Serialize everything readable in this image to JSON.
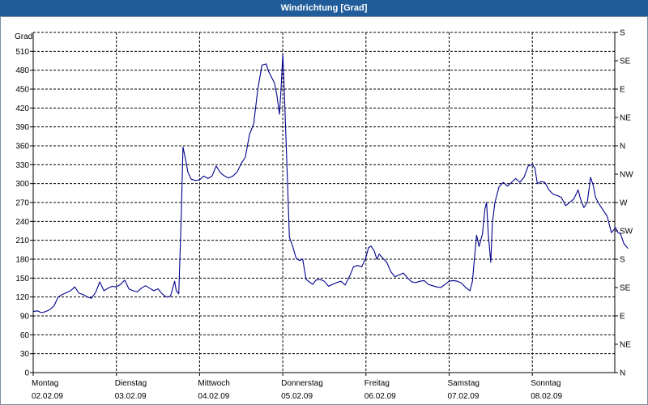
{
  "window": {
    "title": "Windrichtung [Grad]"
  },
  "chart_data": {
    "type": "line",
    "title": "Windrichtung [Grad]",
    "ylabel": "Grad",
    "ylim": [
      0,
      540
    ],
    "y_ticks": [
      0,
      30,
      60,
      90,
      120,
      150,
      180,
      210,
      240,
      270,
      300,
      330,
      360,
      390,
      420,
      450,
      480,
      510
    ],
    "right_axis_ticks": [
      {
        "value": 0,
        "label": "N"
      },
      {
        "value": 45,
        "label": "NE"
      },
      {
        "value": 90,
        "label": "E"
      },
      {
        "value": 135,
        "label": "SE"
      },
      {
        "value": 180,
        "label": "S"
      },
      {
        "value": 225,
        "label": "SW"
      },
      {
        "value": 270,
        "label": "W"
      },
      {
        "value": 315,
        "label": "NW"
      },
      {
        "value": 360,
        "label": "N"
      },
      {
        "value": 405,
        "label": "NE"
      },
      {
        "value": 450,
        "label": "E"
      },
      {
        "value": 495,
        "label": "SE"
      },
      {
        "value": 540,
        "label": "S"
      }
    ],
    "x_range_days": [
      0,
      7
    ],
    "x_ticks": [
      {
        "day": 0,
        "weekday": "Montag",
        "date": "02.02.09"
      },
      {
        "day": 1,
        "weekday": "Dienstag",
        "date": "03.02.09"
      },
      {
        "day": 2,
        "weekday": "Mittwoch",
        "date": "04.02.09"
      },
      {
        "day": 3,
        "weekday": "Donnerstag",
        "date": "05.02.09"
      },
      {
        "day": 4,
        "weekday": "Freitag",
        "date": "06.02.09"
      },
      {
        "day": 5,
        "weekday": "Samstag",
        "date": "07.02.09"
      },
      {
        "day": 6,
        "weekday": "Sonntag",
        "date": "08.02.09"
      }
    ],
    "grid": true,
    "series": [
      {
        "color": "#00008b",
        "points": [
          [
            0.0,
            97
          ],
          [
            0.05,
            98
          ],
          [
            0.1,
            95
          ],
          [
            0.15,
            97
          ],
          [
            0.2,
            100
          ],
          [
            0.25,
            106
          ],
          [
            0.3,
            120
          ],
          [
            0.35,
            124
          ],
          [
            0.4,
            127
          ],
          [
            0.45,
            130
          ],
          [
            0.5,
            136
          ],
          [
            0.55,
            126
          ],
          [
            0.6,
            124
          ],
          [
            0.65,
            120
          ],
          [
            0.7,
            118
          ],
          [
            0.75,
            127
          ],
          [
            0.8,
            144
          ],
          [
            0.85,
            130
          ],
          [
            0.9,
            134
          ],
          [
            0.95,
            137
          ],
          [
            1.0,
            136
          ],
          [
            1.05,
            140
          ],
          [
            1.1,
            147
          ],
          [
            1.15,
            133
          ],
          [
            1.2,
            130
          ],
          [
            1.25,
            128
          ],
          [
            1.3,
            134
          ],
          [
            1.35,
            138
          ],
          [
            1.4,
            134
          ],
          [
            1.45,
            130
          ],
          [
            1.5,
            133
          ],
          [
            1.55,
            125
          ],
          [
            1.6,
            120
          ],
          [
            1.65,
            121
          ],
          [
            1.7,
            145
          ],
          [
            1.72,
            130
          ],
          [
            1.75,
            125
          ],
          [
            1.78,
            250
          ],
          [
            1.8,
            358
          ],
          [
            1.83,
            340
          ],
          [
            1.86,
            318
          ],
          [
            1.9,
            307
          ],
          [
            1.95,
            305
          ],
          [
            2.0,
            306
          ],
          [
            2.05,
            312
          ],
          [
            2.1,
            308
          ],
          [
            2.15,
            312
          ],
          [
            2.2,
            328
          ],
          [
            2.25,
            317
          ],
          [
            2.3,
            312
          ],
          [
            2.35,
            309
          ],
          [
            2.4,
            312
          ],
          [
            2.45,
            318
          ],
          [
            2.5,
            332
          ],
          [
            2.55,
            342
          ],
          [
            2.6,
            378
          ],
          [
            2.65,
            395
          ],
          [
            2.7,
            450
          ],
          [
            2.75,
            488
          ],
          [
            2.8,
            490
          ],
          [
            2.83,
            478
          ],
          [
            2.86,
            470
          ],
          [
            2.9,
            460
          ],
          [
            2.93,
            440
          ],
          [
            2.96,
            410
          ],
          [
            2.98,
            450
          ],
          [
            3.0,
            505
          ],
          [
            3.02,
            440
          ],
          [
            3.05,
            330
          ],
          [
            3.08,
            215
          ],
          [
            3.12,
            200
          ],
          [
            3.16,
            182
          ],
          [
            3.2,
            178
          ],
          [
            3.24,
            180
          ],
          [
            3.28,
            148
          ],
          [
            3.32,
            144
          ],
          [
            3.36,
            140
          ],
          [
            3.4,
            147
          ],
          [
            3.45,
            148
          ],
          [
            3.5,
            145
          ],
          [
            3.55,
            137
          ],
          [
            3.6,
            140
          ],
          [
            3.65,
            143
          ],
          [
            3.7,
            145
          ],
          [
            3.75,
            139
          ],
          [
            3.8,
            152
          ],
          [
            3.85,
            168
          ],
          [
            3.9,
            170
          ],
          [
            3.95,
            168
          ],
          [
            4.0,
            183
          ],
          [
            4.03,
            198
          ],
          [
            4.06,
            201
          ],
          [
            4.1,
            193
          ],
          [
            4.13,
            180
          ],
          [
            4.16,
            188
          ],
          [
            4.2,
            182
          ],
          [
            4.25,
            175
          ],
          [
            4.3,
            160
          ],
          [
            4.35,
            152
          ],
          [
            4.4,
            155
          ],
          [
            4.45,
            158
          ],
          [
            4.5,
            150
          ],
          [
            4.55,
            144
          ],
          [
            4.6,
            143
          ],
          [
            4.65,
            145
          ],
          [
            4.7,
            146
          ],
          [
            4.75,
            140
          ],
          [
            4.8,
            138
          ],
          [
            4.85,
            136
          ],
          [
            4.9,
            135
          ],
          [
            4.95,
            140
          ],
          [
            5.0,
            145
          ],
          [
            5.05,
            146
          ],
          [
            5.1,
            145
          ],
          [
            5.15,
            142
          ],
          [
            5.2,
            135
          ],
          [
            5.25,
            130
          ],
          [
            5.28,
            145
          ],
          [
            5.3,
            175
          ],
          [
            5.33,
            218
          ],
          [
            5.36,
            200
          ],
          [
            5.4,
            220
          ],
          [
            5.43,
            260
          ],
          [
            5.45,
            270
          ],
          [
            5.47,
            220
          ],
          [
            5.5,
            175
          ],
          [
            5.52,
            238
          ],
          [
            5.55,
            270
          ],
          [
            5.6,
            295
          ],
          [
            5.65,
            302
          ],
          [
            5.7,
            296
          ],
          [
            5.75,
            302
          ],
          [
            5.8,
            308
          ],
          [
            5.85,
            302
          ],
          [
            5.9,
            310
          ],
          [
            5.95,
            328
          ],
          [
            6.0,
            330
          ],
          [
            6.03,
            325
          ],
          [
            6.06,
            300
          ],
          [
            6.1,
            303
          ],
          [
            6.15,
            302
          ],
          [
            6.2,
            290
          ],
          [
            6.25,
            283
          ],
          [
            6.3,
            281
          ],
          [
            6.35,
            278
          ],
          [
            6.4,
            265
          ],
          [
            6.45,
            270
          ],
          [
            6.5,
            276
          ],
          [
            6.55,
            290
          ],
          [
            6.58,
            275
          ],
          [
            6.62,
            262
          ],
          [
            6.66,
            270
          ],
          [
            6.7,
            310
          ],
          [
            6.73,
            298
          ],
          [
            6.76,
            278
          ],
          [
            6.8,
            268
          ],
          [
            6.85,
            258
          ],
          [
            6.9,
            248
          ],
          [
            6.95,
            222
          ],
          [
            7.0,
            230
          ],
          [
            7.03,
            222
          ],
          [
            7.06,
            220
          ],
          [
            7.1,
            205
          ],
          [
            7.15,
            197
          ]
        ]
      }
    ]
  }
}
